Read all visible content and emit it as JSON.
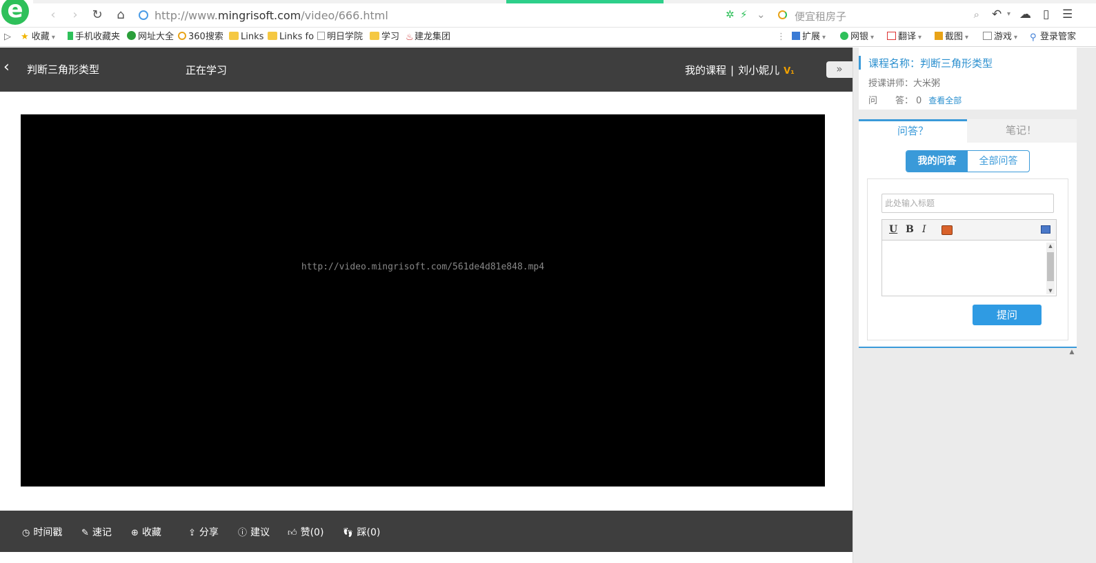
{
  "browser": {
    "url_prefix": "http://www.",
    "url_domain": "mingrisoft.com",
    "url_path": "/video/666.html",
    "search_placeholder": "便宜租房子",
    "nav": {
      "back": "‹",
      "forward": "›",
      "reload": "↻",
      "home": "⌂"
    },
    "toolbar_icons": [
      "undo-icon",
      "cloud-icon",
      "phone-icon",
      "menu-icon"
    ]
  },
  "favorites": {
    "items": [
      {
        "label": "收藏",
        "icon": "star-icon"
      },
      {
        "label": "手机收藏夹",
        "icon": "phone-icon"
      },
      {
        "label": "网址大全",
        "icon": "globe-icon"
      },
      {
        "label": "360搜索",
        "icon": "search-icon"
      },
      {
        "label": "Links",
        "icon": "folder-icon"
      },
      {
        "label": "Links fo",
        "icon": "folder-icon"
      },
      {
        "label": "明日学院",
        "icon": "page-icon"
      },
      {
        "label": "学习",
        "icon": "folder-icon"
      },
      {
        "label": "建龙集团",
        "icon": "page-icon"
      }
    ],
    "right": [
      {
        "label": "扩展"
      },
      {
        "label": "网银"
      },
      {
        "label": "翻译"
      },
      {
        "label": "截图"
      },
      {
        "label": "游戏"
      },
      {
        "label": "登录管家"
      }
    ]
  },
  "header": {
    "course_title": "判断三角形类型",
    "learning_label": "正在学习",
    "my_courses": "我的课程",
    "separator": "|",
    "username": "刘小妮儿",
    "vip": "V₁",
    "expand": "»"
  },
  "player": {
    "video_url": "http://video.mingrisoft.com/561de4d81e848.mp4"
  },
  "toolbar": {
    "timestamp": "时间戳",
    "quicknote": "速记",
    "favorite": "收藏",
    "share": "分享",
    "suggest": "建议",
    "like": "赞(0)",
    "dislike": "踩(0)"
  },
  "sidebar": {
    "course_name": "课程名称：判断三角形类型",
    "teacher": "授课讲师：大米粥",
    "qa_label": "问　　答：",
    "qa_count": "0",
    "view_all": "查看全部",
    "tabs": {
      "qa": "问答？",
      "notes": "笔记！"
    },
    "segments": {
      "mine": "我的问答",
      "all": "全部问答"
    },
    "title_placeholder": "此处输入标题",
    "editor": {
      "underline": "U",
      "bold": "B",
      "italic": "I"
    },
    "ask_button": "提问"
  },
  "colors": {
    "header_bg": "#3e3e3e",
    "accent": "#3a9ad9",
    "button": "#2f9be3",
    "vip": "#f0a000"
  }
}
